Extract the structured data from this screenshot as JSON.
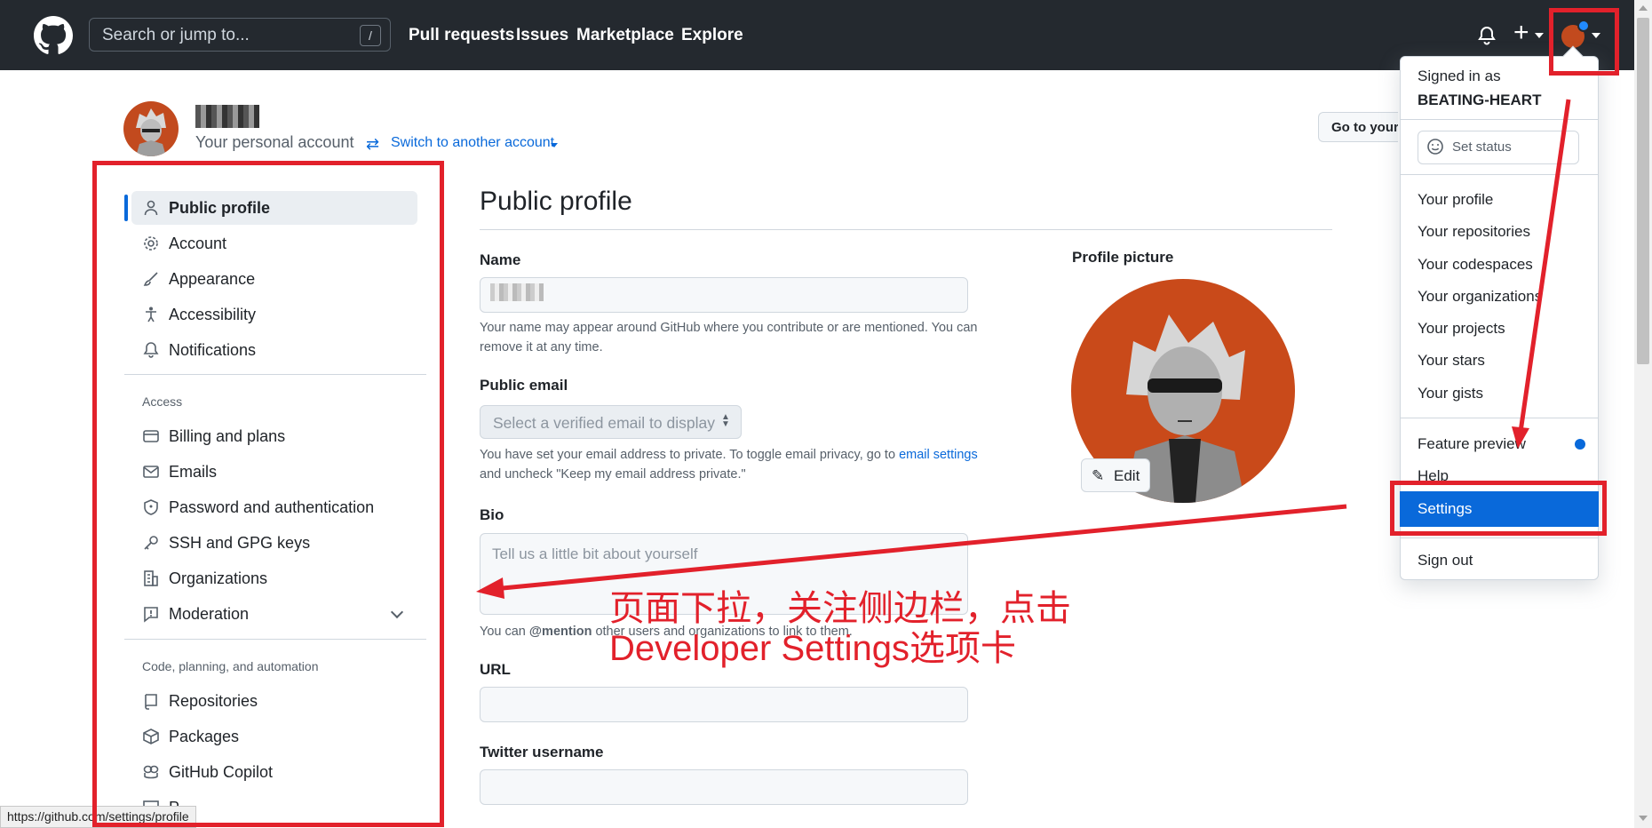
{
  "header": {
    "search_placeholder": "Search or jump to...",
    "search_shortcut": "/",
    "nav": [
      "Pull requests",
      "Issues",
      "Marketplace",
      "Explore"
    ],
    "plus": "+"
  },
  "account": {
    "subtitle": "Your personal account",
    "switch_icon": "⇄",
    "switch_label": "Switch to another account",
    "goto_button": "Go to your"
  },
  "sidebar": {
    "items": [
      {
        "label": "Public profile",
        "icon": "person-icon"
      },
      {
        "label": "Account",
        "icon": "gear-icon"
      },
      {
        "label": "Appearance",
        "icon": "paintbrush-icon"
      },
      {
        "label": "Accessibility",
        "icon": "accessibility-icon"
      },
      {
        "label": "Notifications",
        "icon": "bell-icon"
      },
      {
        "label": "Billing and plans",
        "icon": "credit-card-icon"
      },
      {
        "label": "Emails",
        "icon": "mail-icon"
      },
      {
        "label": "Password and authentication",
        "icon": "shield-icon"
      },
      {
        "label": "SSH and GPG keys",
        "icon": "key-icon"
      },
      {
        "label": "Organizations",
        "icon": "organization-icon"
      },
      {
        "label": "Moderation",
        "icon": "report-icon"
      },
      {
        "label": "Repositories",
        "icon": "repo-icon"
      },
      {
        "label": "Packages",
        "icon": "package-icon"
      },
      {
        "label": "GitHub Copilot",
        "icon": "copilot-icon"
      },
      {
        "label": "P",
        "icon": "project-icon"
      }
    ],
    "section_access": "Access",
    "section_code": "Code, planning, and automation"
  },
  "main": {
    "title": "Public profile",
    "name_label": "Name",
    "name_note": "Your name may appear around GitHub where you contribute or are mentioned. You can remove it at any time.",
    "email_label": "Public email",
    "email_select": "Select a verified email to display",
    "email_note_1": "You have set your email address to private. To toggle email privacy, go to ",
    "email_note_link": "email settings",
    "email_note_2": " and uncheck \"Keep my email address private.\"",
    "bio_label": "Bio",
    "bio_placeholder": "Tell us a little bit about yourself",
    "bio_note_1": "You can ",
    "bio_note_bold": "@mention",
    "bio_note_2": " other users and organizations to link to them.",
    "url_label": "URL",
    "twitter_label": "Twitter username",
    "picture_label": "Profile picture",
    "edit_button": "Edit",
    "edit_icon": "✎"
  },
  "dropdown": {
    "signed_in_as": "Signed in as",
    "username": "BEATING-HEART",
    "set_status": "Set status",
    "items": [
      "Your profile",
      "Your repositories",
      "Your codespaces",
      "Your organizations",
      "Your projects",
      "Your stars",
      "Your gists"
    ],
    "feature_preview": "Feature preview",
    "help": "Help",
    "settings": "Settings",
    "sign_out": "Sign out"
  },
  "status_url": "https://github.com/settings/profile",
  "annotation": {
    "line1": "页面下拉，关注侧边栏，点击",
    "line2": "Developer Settings选项卡"
  },
  "colors": {
    "header_bg": "#24292f",
    "accent": "#0969da",
    "annotation": "#e2212b",
    "avatar": "#c94a1a"
  }
}
